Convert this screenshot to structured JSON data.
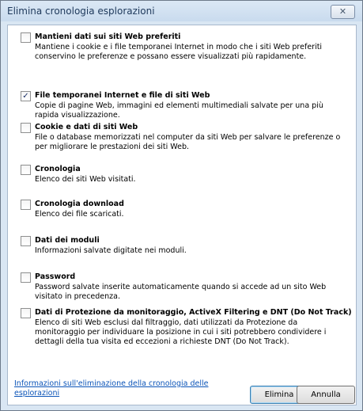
{
  "window": {
    "title": "Elimina cronologia esplorazioni",
    "close_glyph": "✕"
  },
  "options": [
    {
      "label": "Mantieni dati sui siti Web preferiti",
      "checked": false,
      "description": "Mantiene i cookie e i file temporanei Internet in modo che i siti Web preferiti conservino le preferenze e possano essere visualizzati più rapidamente."
    },
    {
      "label": "File temporanei Internet e file di siti Web",
      "checked": true,
      "description": "Copie di pagine Web, immagini ed elementi multimediali salvate per una più rapida visualizzazione."
    },
    {
      "label": "Cookie e dati di siti Web",
      "checked": false,
      "description": "File o database memorizzati nel computer da siti Web per salvare le preferenze o per migliorare le prestazioni dei siti Web."
    },
    {
      "label": "Cronologia",
      "checked": false,
      "description": "Elenco dei siti Web visitati."
    },
    {
      "label": "Cronologia download",
      "checked": false,
      "description": "Elenco dei file scaricati."
    },
    {
      "label": "Dati dei moduli",
      "checked": false,
      "description": "Informazioni salvate digitate nei moduli."
    },
    {
      "label": "Password",
      "checked": false,
      "description": "Password salvate inserite automaticamente quando si accede ad un sito Web visitato in precedenza."
    },
    {
      "label": "Dati di Protezione da monitoraggio, ActiveX Filtering e DNT (Do Not Track)",
      "checked": false,
      "description": "Elenco di siti Web esclusi dal filtraggio, dati utilizzati da Protezione da monitoraggio per individuare la posizione in cui i siti potrebbero condividere i dettagli della tua visita ed eccezioni a richieste DNT (Do Not Track)."
    }
  ],
  "footer": {
    "help_link": "Informazioni sull'eliminazione della cronologia delle esplorazioni",
    "delete_label": "Elimina",
    "cancel_label": "Annulla"
  },
  "colors": {
    "link": "#0b54b8",
    "title_text": "#1e395b",
    "frame": "#d9e6f3"
  }
}
